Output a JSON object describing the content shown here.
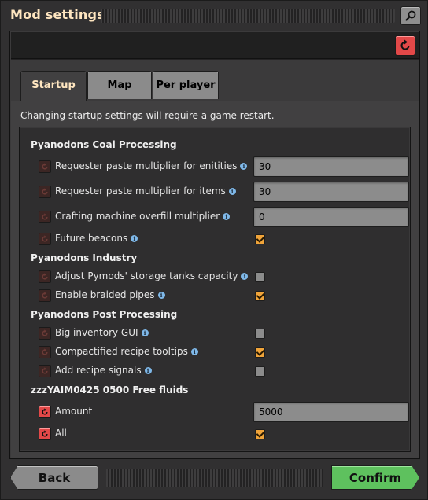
{
  "window": {
    "title": "Mod settings"
  },
  "tabs": [
    {
      "label": "Startup",
      "active": true
    },
    {
      "label": "Map",
      "active": false
    },
    {
      "label": "Per player",
      "active": false
    }
  ],
  "note": "Changing startup settings will require a game restart.",
  "groups": [
    {
      "heading": "Pyanodons Coal Processing",
      "rows": [
        {
          "label": "Requester paste multiplier for enitities",
          "info": true,
          "type": "text",
          "value": "30",
          "modified": false
        },
        {
          "label": "Requester paste multiplier for items",
          "info": true,
          "type": "text",
          "value": "30",
          "modified": false
        },
        {
          "label": "Crafting machine overfill multiplier",
          "info": true,
          "type": "text",
          "value": "0",
          "modified": false
        },
        {
          "label": "Future beacons",
          "info": true,
          "type": "checkbox",
          "checked": true,
          "modified": false
        }
      ]
    },
    {
      "heading": "Pyanodons Industry",
      "rows": [
        {
          "label": "Adjust Pymods' storage tanks capacity",
          "info": true,
          "type": "checkbox",
          "checked": false,
          "modified": false
        },
        {
          "label": "Enable braided pipes",
          "info": true,
          "type": "checkbox",
          "checked": true,
          "modified": false
        }
      ]
    },
    {
      "heading": "Pyanodons Post Processing",
      "rows": [
        {
          "label": "Big inventory GUI",
          "info": true,
          "type": "checkbox",
          "checked": false,
          "modified": false
        },
        {
          "label": "Compactified recipe tooltips",
          "info": true,
          "type": "checkbox",
          "checked": true,
          "modified": false
        },
        {
          "label": "Add recipe signals",
          "info": true,
          "type": "checkbox",
          "checked": false,
          "modified": false
        }
      ]
    },
    {
      "heading": "zzzYAIM0425 0500 Free fluids",
      "rows": [
        {
          "label": "Amount",
          "info": false,
          "type": "text",
          "value": "5000",
          "modified": true
        },
        {
          "label": "All",
          "info": false,
          "type": "checkbox",
          "checked": true,
          "modified": true
        }
      ]
    }
  ],
  "footer": {
    "back_label": "Back",
    "confirm_label": "Confirm"
  },
  "icons": {
    "info": "i",
    "reset": "reset-icon",
    "search": "search-icon"
  },
  "colors": {
    "accent": "#ffe6c0",
    "confirm": "#5ec15e",
    "reset": "#e24848",
    "checked": "#f0a43a"
  }
}
